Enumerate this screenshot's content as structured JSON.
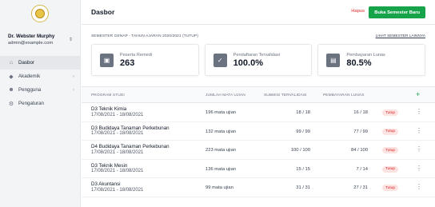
{
  "sidebar": {
    "user": {
      "name": "Dr. Webster Murphy",
      "email": "admin@example.com"
    },
    "items": [
      {
        "label": "Dasbor",
        "icon": "home-icon"
      },
      {
        "label": "Akademik",
        "icon": "graduation-cap-icon"
      },
      {
        "label": "Pengguna",
        "icon": "users-icon"
      },
      {
        "label": "Pengaturan",
        "icon": "gear-icon"
      }
    ]
  },
  "header": {
    "title": "Dasbor",
    "delete_label": "Hapus",
    "new_semester_label": "Buka Semester Baru"
  },
  "semester": {
    "label": "SEMESTER GENAP - TAHUN AJARAN 2020/2021 (TUTUP)",
    "other_link": "LIHAT SEMESTER LAINNYA"
  },
  "stats": [
    {
      "label": "Peserta Remedi",
      "value": "263",
      "icon": "user-badge-icon"
    },
    {
      "label": "Pendaftaran Tervalidasi",
      "value": "100.0%",
      "icon": "check-circle-icon"
    },
    {
      "label": "Pembayaran Lunas",
      "value": "80.5%",
      "icon": "money-icon"
    }
  ],
  "table": {
    "headers": {
      "program": "PROGRAM STUDI",
      "jumlah": "JUMLAH MATA UJIAN",
      "submisi": "SUBMISI TERVALIDASI",
      "pembayaran": "PEMBAYARAN LUNAS",
      "add": "+"
    },
    "rows": [
      {
        "program": "D3 Teknik Kimia",
        "dates": "17/08/2021 - 18/08/2021",
        "jumlah": "196 mata ujian",
        "submisi": "18 / 18",
        "pembayaran": "16 / 18",
        "status": "Tutup"
      },
      {
        "program": "D3 Budidaya Tanaman Perkebunan",
        "dates": "17/08/2021 - 18/08/2021",
        "jumlah": "132 mata ujian",
        "submisi": "99 / 99",
        "pembayaran": "77 / 99",
        "status": "Tutup"
      },
      {
        "program": "D4 Budidaya Tanaman Perkebunan",
        "dates": "17/08/2021 - 18/08/2021",
        "jumlah": "223 mata ujian",
        "submisi": "100 / 100",
        "pembayaran": "84 / 100",
        "status": "Tutup"
      },
      {
        "program": "D3 Teknik Mesin",
        "dates": "17/08/2021 - 18/08/2021",
        "jumlah": "136 mata ujian",
        "submisi": "15 / 15",
        "pembayaran": "7 / 14",
        "status": "Tutup"
      },
      {
        "program": "D3 Akuntansi",
        "dates": "17/08/2021 - 18/08/2021",
        "jumlah": "99 mata ujian",
        "submisi": "31 / 31",
        "pembayaran": "27 / 31",
        "status": "Tutup"
      }
    ]
  },
  "colors": {
    "primary": "#16a34a",
    "danger": "#dc2626",
    "badge_bg": "#fde2e2"
  }
}
